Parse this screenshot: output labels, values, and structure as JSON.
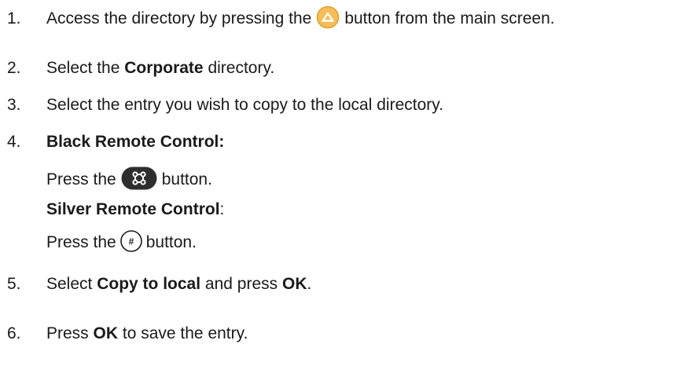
{
  "steps": [
    {
      "number": "1.",
      "before": "Access the directory by pressing the",
      "icon": "directory-up-button-icon",
      "after": "button from the main screen."
    },
    {
      "number": "2.",
      "before": "Select the",
      "bold": "Corporate",
      "after": "directory."
    },
    {
      "number": "3.",
      "text": "Select the entry you wish to copy to the local directory."
    },
    {
      "number": "4.",
      "black_heading": "Black Remote Control:",
      "black_press_before": "Press the",
      "black_icon": "command-button-icon",
      "black_press_after": "button.",
      "silver_heading": "Silver Remote Control",
      "silver_colon": ":",
      "silver_press_before": "Press the",
      "silver_icon": "hash-button-icon",
      "silver_icon_glyph": "#",
      "silver_press_after": "button."
    },
    {
      "number": "5.",
      "before": "Select",
      "bold1": "Copy to local",
      "middle": "and press",
      "bold2": "OK",
      "after": "."
    },
    {
      "number": "6.",
      "before": "Press",
      "bold": "OK",
      "after": "to save the entry."
    }
  ],
  "colors": {
    "text": "#1a1a1a",
    "up_button_fill": "#f7bd54",
    "up_button_border": "#e2a030",
    "command_button_fill": "#2e2e2e",
    "hash_button_border": "#1a1a1a"
  }
}
